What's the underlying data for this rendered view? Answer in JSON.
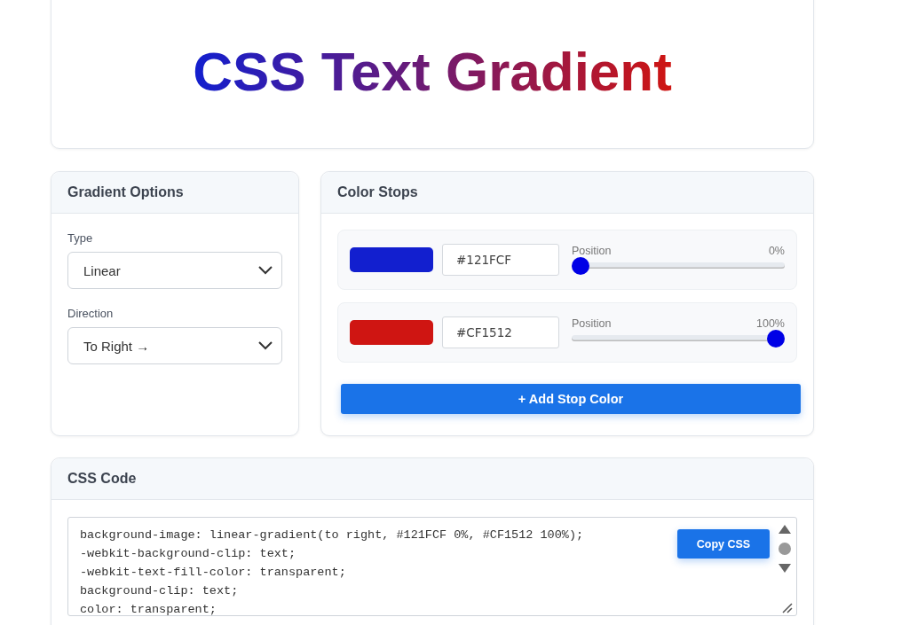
{
  "preview": {
    "text": "CSS Text Gradient"
  },
  "options": {
    "title": "Gradient Options",
    "fields": [
      {
        "label": "Type",
        "value": "Linear"
      },
      {
        "label": "Direction",
        "value": "To Right →"
      }
    ]
  },
  "stops": {
    "title": "Color Stops",
    "items": [
      {
        "color": "#121fcf",
        "hex": "#121FCF",
        "label": "Position",
        "reading": "0%",
        "level": 0
      },
      {
        "color": "#cf1512",
        "hex": "#CF1512",
        "label": "Position",
        "reading": "100%",
        "level": 1
      }
    ],
    "add_button": "+ Add Stop Color"
  },
  "code": {
    "title": "CSS Code",
    "copy_button": "Copy CSS",
    "lines": [
      "background-image: linear-gradient(to right, #121FCF 0%, #CF1512 100%);",
      "-webkit-background-clip: text;",
      "-webkit-text-fill-color: transparent;",
      "background-clip: text;",
      "color: transparent;"
    ]
  }
}
